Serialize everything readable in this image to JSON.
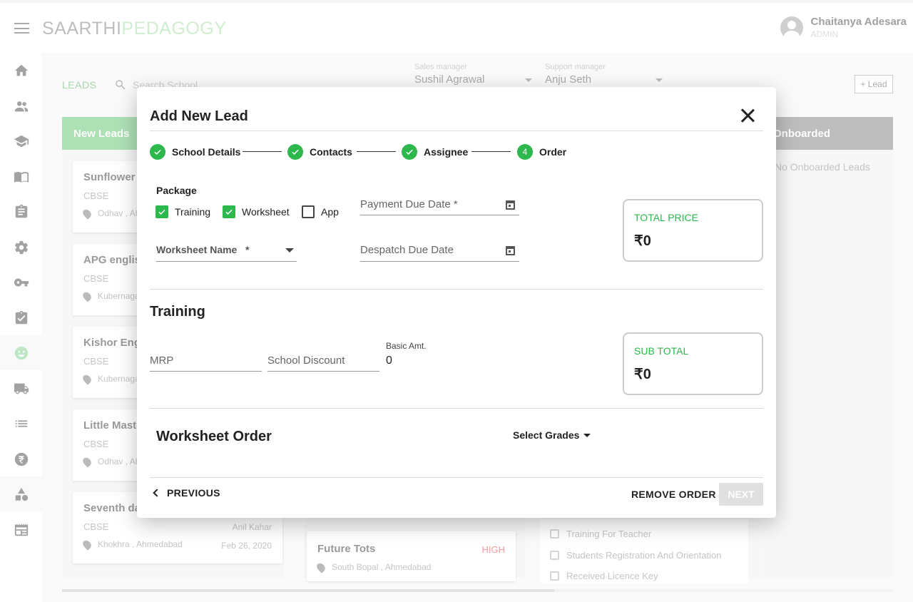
{
  "app": {
    "logo_part1": "SAARTHI",
    "logo_part2": "PEDAGOGY",
    "user_name": "Chaitanya Adesara",
    "user_role": "ADMIN"
  },
  "sidebar": {
    "items": [
      "home-icon",
      "people-icon",
      "school-icon",
      "book-icon",
      "assignment-icon",
      "settings-icon",
      "key-icon",
      "task-icon",
      "face-icon",
      "truck-icon",
      "list-icon",
      "rupee-icon",
      "shapes-icon",
      "newspaper-icon"
    ],
    "active_index": 8
  },
  "toolbar": {
    "leads_label": "LEADS",
    "search_placeholder": "Search School",
    "sales_manager_label": "Sales manager",
    "sales_manager_value": "Sushil Agrawal",
    "support_manager_label": "Support manager",
    "support_manager_value": "Anju Seth",
    "add_lead_label": "+ Lead"
  },
  "board": {
    "new_leads_header": "New Leads",
    "onboarded_header": "Onboarded",
    "no_onboarded_text": "No Onboarded Leads",
    "cards": [
      {
        "title": "Sunflower e",
        "board": "CBSE",
        "location": "Odhav , Ah"
      },
      {
        "title": "APG englis",
        "board": "CBSE",
        "location": "Kubernaga"
      },
      {
        "title": "Kishor Engl",
        "board": "CBSE",
        "location": "Kubernaga"
      },
      {
        "title": "Little Maste",
        "board": "CBSE",
        "location": "Odhav , Ah"
      },
      {
        "title": "Seventh da",
        "board": "CBSE",
        "location": "Khokhra , Ahmedabad",
        "assignee": "Anil Kahar",
        "date": "Feb 26, 2020"
      }
    ],
    "middle_card": {
      "title": "Future Tots",
      "priority": "HIGH",
      "location": "South Bopal , Ahmedabad"
    },
    "checklist": [
      "Training For Teacher",
      "Students Registration And Orientation",
      "Received Licence Key"
    ]
  },
  "modal": {
    "title": "Add New Lead",
    "steps": [
      {
        "label": "School Details",
        "state": "done"
      },
      {
        "label": "Contacts",
        "state": "done"
      },
      {
        "label": "Assignee",
        "state": "done"
      },
      {
        "label": "Order",
        "state": "active",
        "number": "4"
      }
    ],
    "package_label": "Package",
    "packages": [
      {
        "label": "Training",
        "checked": true
      },
      {
        "label": "Worksheet",
        "checked": true
      },
      {
        "label": "App",
        "checked": false
      }
    ],
    "payment_due_label": "Payment Due Date *",
    "worksheet_name_label": "Worksheet Name   *",
    "despatch_due_label": "Despatch Due Date",
    "total_price_label": "TOTAL PRICE",
    "total_price_value": "₹0",
    "training_title": "Training",
    "mrp_label": "MRP",
    "school_discount_label": "School Discount",
    "basic_amt_label": "Basic Amt.",
    "basic_amt_value": "0",
    "sub_total_label": "SUB TOTAL",
    "sub_total_value": "₹0",
    "worksheet_order_title": "Worksheet Order",
    "select_grades_label": "Select Grades",
    "previous_label": "PREVIOUS",
    "remove_order_label": "REMOVE ORDER",
    "next_label": "NEXT",
    "accent_color": "#2db84d"
  }
}
